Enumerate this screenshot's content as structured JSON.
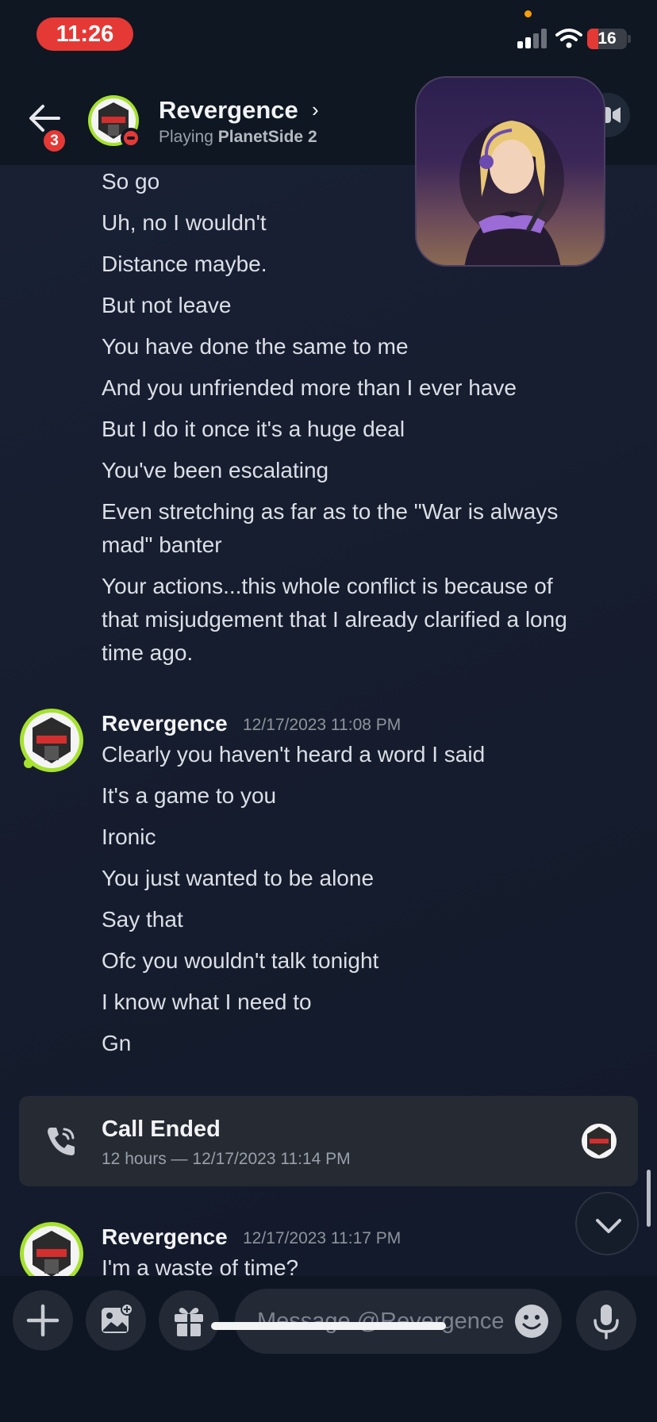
{
  "status_bar": {
    "time": "11:26",
    "battery": "16"
  },
  "header": {
    "back_badge": "3",
    "name": "Revergence",
    "chevron": "›",
    "activity_prefix": "Playing",
    "activity_game": "PlanetSide 2"
  },
  "chat": {
    "earlier_lines": [
      "So go",
      "Uh, no I wouldn't",
      "Distance maybe.",
      "But not leave",
      "You have done the same to me",
      "And you unfriended more than I ever have",
      "But I do it once it's a huge deal",
      "You've been escalating",
      "Even stretching as far as to the \"War is always",
      "mad\" banter",
      "Your actions...this whole conflict is because of",
      "that misjudgement that I already clarified a long",
      "time ago."
    ],
    "group1": {
      "author": "Revergence",
      "timestamp": "12/17/2023 11:08 PM",
      "lines": [
        "Clearly you haven't heard a word I said",
        "It's a game to you",
        "Ironic",
        "You just wanted to be alone",
        "Say that",
        "Ofc you wouldn't talk tonight",
        "I know what I need to",
        "Gn"
      ]
    },
    "call_card": {
      "title": "Call Ended",
      "subtitle": "12 hours — 12/17/2023 11:14 PM"
    },
    "group2": {
      "author": "Revergence",
      "timestamp": "12/17/2023 11:17 PM",
      "first_line": "I'm a waste of time?"
    }
  },
  "composer": {
    "placeholder": "Message @Revergence"
  },
  "colors": {
    "accent_red": "#e53935",
    "status_green": "#a6e22e",
    "background": "#161d2e"
  },
  "icons": [
    "back-arrow-icon",
    "video-icon",
    "phone-icon",
    "chevron-down-icon",
    "plus-icon",
    "image-icon",
    "gift-icon",
    "emoji-icon",
    "microphone-icon"
  ]
}
